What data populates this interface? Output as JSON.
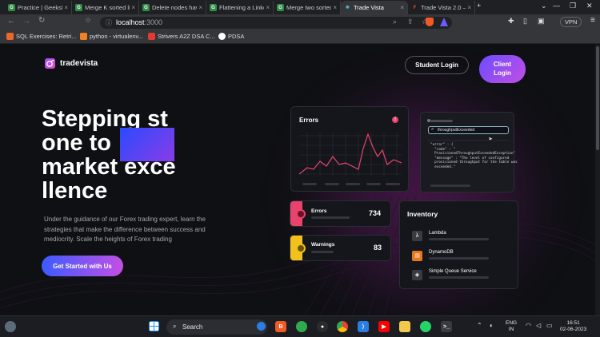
{
  "browser": {
    "tabs": [
      {
        "label": "Practice | GeeksforG",
        "icon": "gfg-icon",
        "active": false
      },
      {
        "label": "Merge K sorted link",
        "icon": "gfg-icon",
        "active": false
      },
      {
        "label": "Delete nodes having",
        "icon": "gfg-icon",
        "active": false
      },
      {
        "label": "Flattening a Linked",
        "icon": "gfg-icon",
        "active": false
      },
      {
        "label": "Merge two sorted li",
        "icon": "gfg-icon",
        "active": false
      },
      {
        "label": "Trade Vista",
        "icon": "react-icon",
        "active": true
      },
      {
        "label": "Trade Vista 2.0 – Fig",
        "icon": "figma-icon",
        "active": false
      }
    ],
    "url_host": "localhost",
    "url_port": ":3000",
    "vpn_label": "VPN",
    "bookmarks": [
      {
        "label": "SQL Exercises: Retri...",
        "icon": "w3r-icon"
      },
      {
        "label": "python - virtualenv...",
        "icon": "stackoverflow-icon"
      },
      {
        "label": "Strivers A2Z DSA C...",
        "icon": "tuf-icon"
      },
      {
        "label": "PDSA",
        "icon": "github-icon"
      }
    ]
  },
  "site": {
    "logo": "tradevista",
    "nav": {
      "student_login": "Student Login",
      "client_login": "Client\nLogin"
    },
    "hero": {
      "title": "Stepping st\none to\nmarket exce\nllence",
      "subtitle": "Under the guidance of our Forex trading expert, learn the strategies that make the difference between success and mediocrity. Scale the heights of Forex trading",
      "cta": "Get Started with Us"
    },
    "errors_card": {
      "title": "Errors"
    },
    "code_card": {
      "search_text": "throughputExceeded",
      "code_lines": [
        "\"error\" : {",
        "  \"code\" : \"",
        "  ProvisionedThroughputExceededException\"",
        "  \"message\" : \"The level of configured",
        "  provisioned throughput for the table was",
        "  exceeded.\""
      ]
    },
    "stats": [
      {
        "label": "Errors",
        "value": "734",
        "accent": "#e8446b"
      },
      {
        "label": "Warnings",
        "value": "83",
        "accent": "#f1c21b"
      }
    ],
    "inventory": {
      "title": "Inventory",
      "items": [
        {
          "label": "Lambda",
          "icon": "lambda-icon"
        },
        {
          "label": "DynamoDB",
          "icon": "dynamodb-icon"
        },
        {
          "label": "Simple Queue Service",
          "icon": "sqs-icon"
        }
      ]
    }
  },
  "taskbar": {
    "search_label": "Search",
    "language_1": "ENG",
    "language_2": "IN",
    "time": "16:51",
    "date": "02-06-2023"
  },
  "colors": {
    "accent_pink": "#e24cc4",
    "accent_purple": "#6a4cff",
    "error_red": "#e8446b",
    "warning_yellow": "#f1c21b"
  }
}
